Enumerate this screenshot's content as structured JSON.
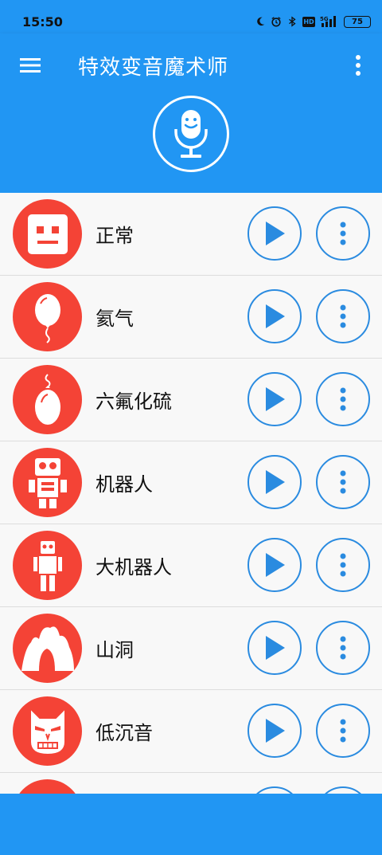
{
  "status_bar": {
    "time": "15:50",
    "icons": [
      "moon-icon",
      "alarm-icon",
      "bluetooth-icon",
      "hd-icon",
      "5g-signal-icon",
      "battery-icon"
    ],
    "hd_label": "HD",
    "battery_level": "75"
  },
  "toolbar": {
    "title": "特效变音魔术师",
    "menu_icon": "hamburger-menu-icon",
    "more_icon": "more-vertical-icon",
    "mic_icon": "microphone-icon"
  },
  "colors": {
    "primary": "#2196f3",
    "accent_red": "#f44336",
    "button_blue": "#2a8be0",
    "row_bg": "#f8f8f8"
  },
  "effects": [
    {
      "label": "正常",
      "icon": "robot-face-icon"
    },
    {
      "label": "氦气",
      "icon": "balloon-icon"
    },
    {
      "label": "六氟化硫",
      "icon": "heavy-balloon-icon"
    },
    {
      "label": "机器人",
      "icon": "robot-icon"
    },
    {
      "label": "大机器人",
      "icon": "big-robot-icon"
    },
    {
      "label": "山洞",
      "icon": "cave-icon"
    },
    {
      "label": "低沉音",
      "icon": "devil-mask-icon"
    },
    {
      "label": "",
      "icon": "effect-icon"
    }
  ]
}
